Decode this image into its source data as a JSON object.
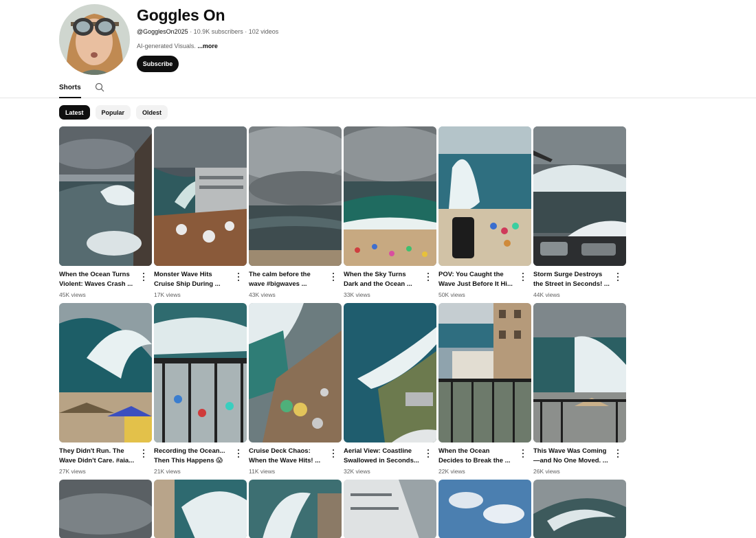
{
  "channel": {
    "name": "Goggles On",
    "handle": "@GogglesOn2025",
    "stats": " · 10.9K subscribers · 102 videos",
    "description": "AI-generated Visuals. ",
    "more_label": "...more",
    "subscribe_label": "Subscribe"
  },
  "tabs": {
    "shorts_label": "Shorts",
    "search_icon": "search-icon"
  },
  "chips": [
    {
      "label": "Latest",
      "active": true
    },
    {
      "label": "Popular",
      "active": false
    },
    {
      "label": "Oldest",
      "active": false
    }
  ],
  "videos": [
    {
      "title": "When the Ocean Turns Violent: Waves Crash ...",
      "views": "45K views"
    },
    {
      "title": "Monster Wave Hits Cruise Ship During ...",
      "views": "17K views"
    },
    {
      "title": "The calm before the wave #bigwaves ...",
      "views": "43K views"
    },
    {
      "title": "When the Sky Turns Dark and the Ocean ...",
      "views": "33K views"
    },
    {
      "title": "POV: You Caught the Wave Just Before It Hi...",
      "views": "50K views"
    },
    {
      "title": "Storm Surge Destroys the Street in Seconds! ...",
      "views": "44K views"
    },
    {
      "title": "They Didn't Run. The Wave Didn't Care. #aia...",
      "views": "27K views"
    },
    {
      "title": "Recording the Ocean... Then This Happens 😱",
      "views": "21K views"
    },
    {
      "title": "Cruise Deck Chaos: When the Wave Hits! ...",
      "views": "11K views"
    },
    {
      "title": "Aerial View: Coastline Swallowed in Seconds...",
      "views": "32K views"
    },
    {
      "title": "When the Ocean Decides to Break the ...",
      "views": "22K views"
    },
    {
      "title": "This Wave Was Coming —and No One Moved. ...",
      "views": "26K views"
    }
  ],
  "colors": {
    "accent": "#0f0f0f",
    "chip_bg": "#f2f2f2",
    "muted_text": "#606060"
  }
}
